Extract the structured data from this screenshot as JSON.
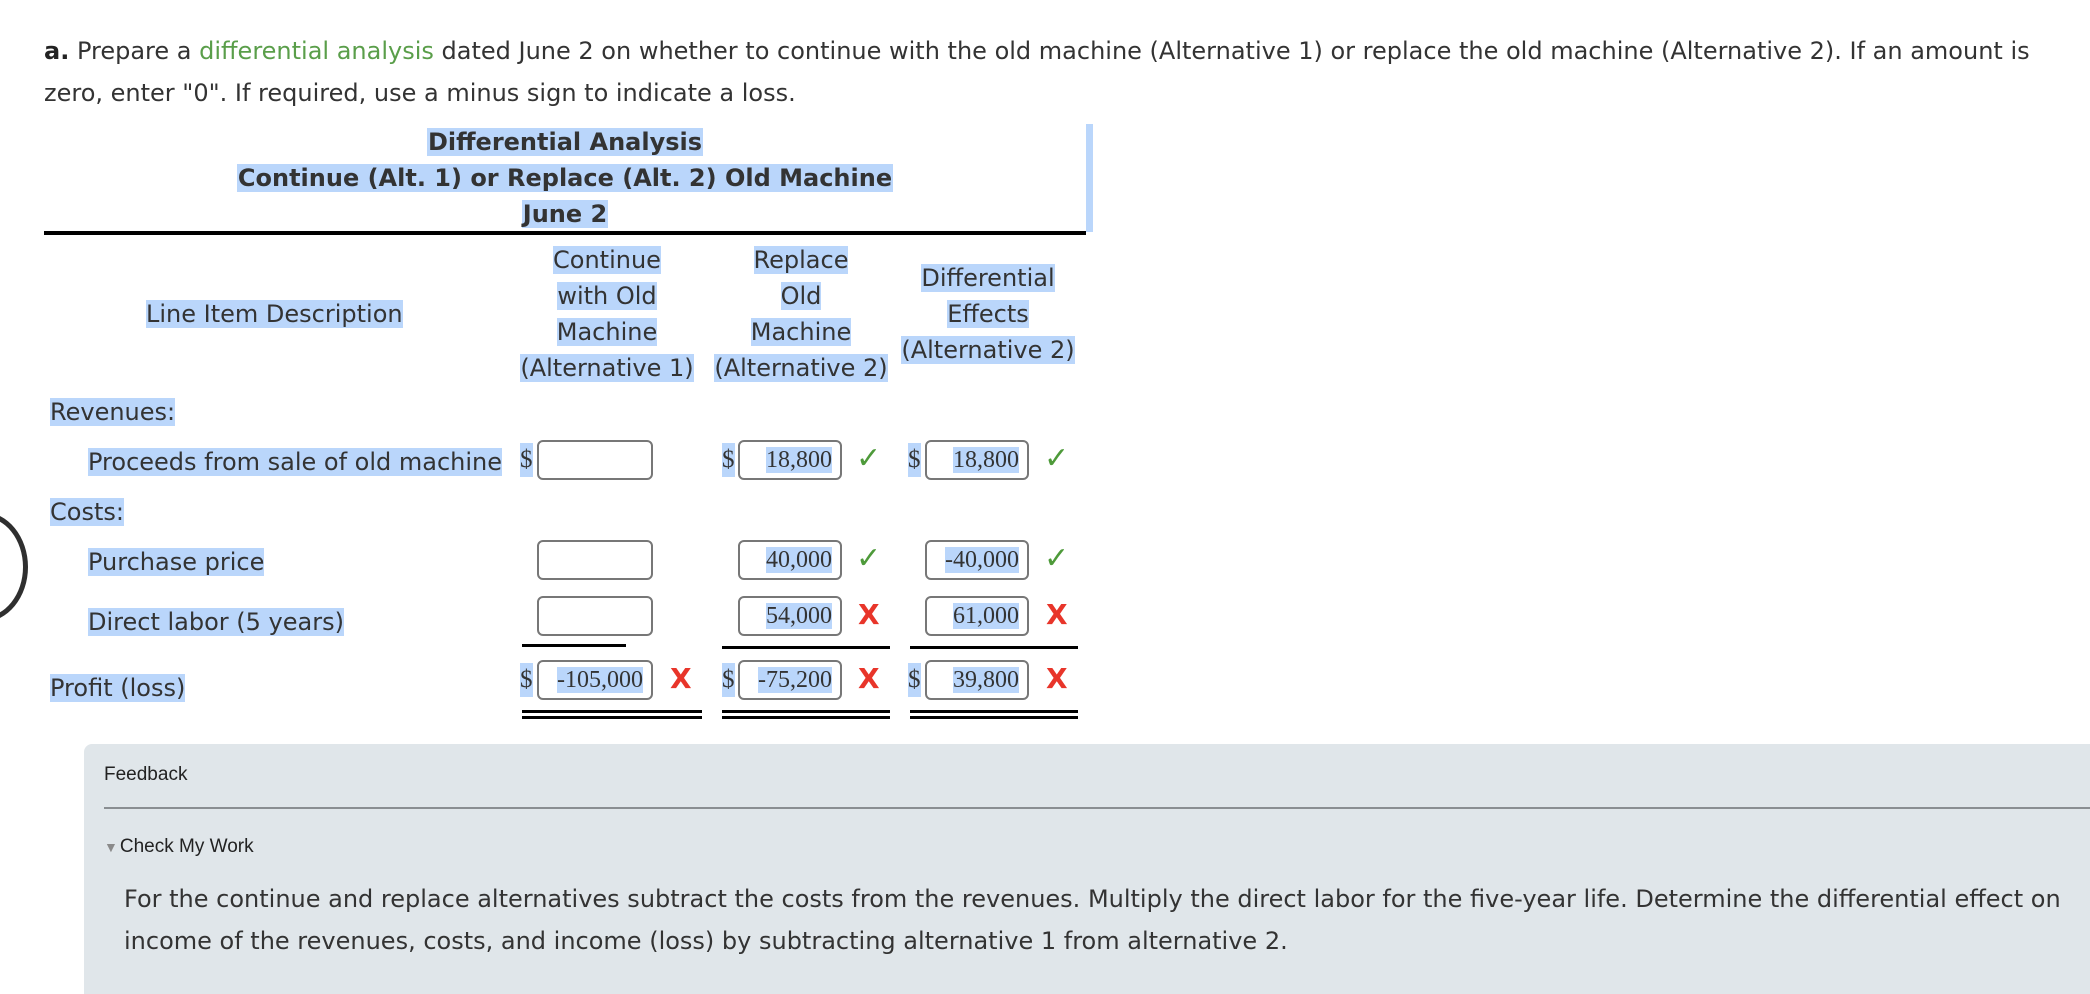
{
  "prompt": {
    "label": "a.",
    "pre": " Prepare a ",
    "term": "differential analysis",
    "post": " dated June 2 on whether to continue with the old machine (Alternative 1) or replace the old machine (Alternative 2). If an amount is zero, enter \"0\". If required, use a minus sign to indicate a loss."
  },
  "title": {
    "line1": "Differential Analysis",
    "line2": "Continue (Alt. 1) or Replace (Alt. 2) Old Machine",
    "line3": "June 2"
  },
  "headers": {
    "description": "Line Item Description",
    "alt1": [
      "Continue",
      "with Old",
      "Machine",
      "(Alternative 1)"
    ],
    "alt2": [
      "Replace",
      "Old",
      "Machine",
      "(Alternative 2)"
    ],
    "diff": [
      "Differential",
      "Effects",
      "(Alternative 2)"
    ]
  },
  "sections": {
    "revenues": "Revenues:",
    "costs": "Costs:"
  },
  "rows": {
    "proceeds": {
      "label": "Proceeds from sale of old machine",
      "alt1": {
        "value": "",
        "status": ""
      },
      "alt2": {
        "value": "18,800",
        "status": "correct"
      },
      "diff": {
        "value": "18,800",
        "status": "correct"
      }
    },
    "purchase": {
      "label": "Purchase price",
      "alt1": {
        "value": "",
        "status": ""
      },
      "alt2": {
        "value": "40,000",
        "status": "correct"
      },
      "diff": {
        "value": "-40,000",
        "status": "correct"
      }
    },
    "labor": {
      "label": "Direct labor (5 years)",
      "alt1": {
        "value": "",
        "status": ""
      },
      "alt2": {
        "value": "54,000",
        "status": "incorrect"
      },
      "diff": {
        "value": "61,000",
        "status": "incorrect"
      }
    },
    "profit": {
      "label": "Profit (loss)",
      "alt1": {
        "value": "-105,000",
        "status": "incorrect"
      },
      "alt2": {
        "value": "-75,200",
        "status": "incorrect"
      },
      "diff": {
        "value": "39,800",
        "status": "incorrect"
      }
    }
  },
  "currency_symbol": "$",
  "icons": {
    "correct": "✓",
    "incorrect": "X"
  },
  "colors": {
    "correct": "#4e9a3a",
    "incorrect": "#e8352a",
    "highlight": "#bad6fb",
    "term": "#5a9e4a",
    "feedback_bg": "#e0e6ea"
  },
  "feedback": {
    "title": "Feedback",
    "toggle": "Check My Work",
    "text": "For the continue and replace alternatives subtract the costs from the revenues. Multiply the direct labor for the five-year life. Determine the differential effect on income of the revenues, costs, and income (loss) by subtracting alternative 1 from alternative 2."
  }
}
